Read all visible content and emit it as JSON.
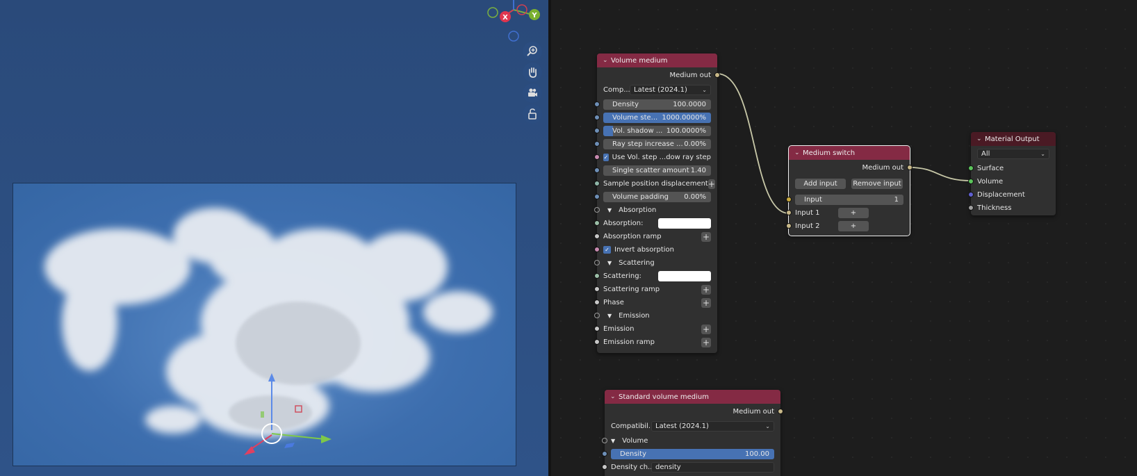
{
  "viewport": {
    "gizmo": {
      "x": "X",
      "y": "Y"
    },
    "tools": [
      "zoom-icon",
      "hand-pan-icon",
      "camera-icon",
      "lock-icon"
    ]
  },
  "nodes": {
    "volume_medium": {
      "title": "Volume medium",
      "output": "Medium out",
      "compat_label": "Comp...",
      "compat_value": "Latest (2024.1)",
      "density_label": "Density",
      "density_value": "100.0000",
      "vol_step_label": "Volume ste...",
      "vol_step_value": "1000.0000%",
      "vol_shadow_label": "Vol. shadow ...",
      "vol_shadow_value": "100.0000%",
      "ray_step_label": "Ray step increase ...",
      "ray_step_value": "0.00%",
      "use_vol_step": "Use Vol. step ...dow ray step",
      "single_scatter_label": "Single scatter amount",
      "single_scatter_value": "1.40",
      "sample_pos": "Sample position displacement",
      "vol_padding_label": "Volume padding",
      "vol_padding_value": "0.00%",
      "absorption_panel": "Absorption",
      "absorption": "Absorption:",
      "absorption_ramp": "Absorption ramp",
      "invert_absorption": "Invert absorption",
      "scattering_panel": "Scattering",
      "scattering": "Scattering:",
      "scattering_ramp": "Scattering ramp",
      "phase": "Phase",
      "emission_panel": "Emission",
      "emission": "Emission",
      "emission_ramp": "Emission ramp"
    },
    "medium_switch": {
      "title": "Medium switch",
      "output": "Medium out",
      "add_input": "Add input",
      "remove_input": "Remove input",
      "input_label": "Input",
      "input_value": "1",
      "input1": "Input 1",
      "input2": "Input 2"
    },
    "material_output": {
      "title": "Material Output",
      "target": "All",
      "surface": "Surface",
      "volume": "Volume",
      "displacement": "Displacement",
      "thickness": "Thickness"
    },
    "standard_volume": {
      "title": "Standard volume medium",
      "output": "Medium out",
      "compat_label": "Compatibil...",
      "compat_value": "Latest (2024.1)",
      "volume_panel": "Volume",
      "density_label": "Density",
      "density_value": "100.00",
      "density_channel_label": "Density ch...",
      "density_channel_value": "density"
    }
  },
  "colors": {
    "node_header": "#842a44",
    "output_header": "#4a1a24",
    "field_blue": "#4772b3",
    "socket_float": "#6e8fb7",
    "socket_color": "#c8c8c8",
    "socket_bool": "#c88ab0",
    "socket_medium": "#c8b888",
    "socket_shader": "#5cc45c",
    "socket_vector": "#6060d0",
    "socket_yellow": "#c8a83c"
  }
}
